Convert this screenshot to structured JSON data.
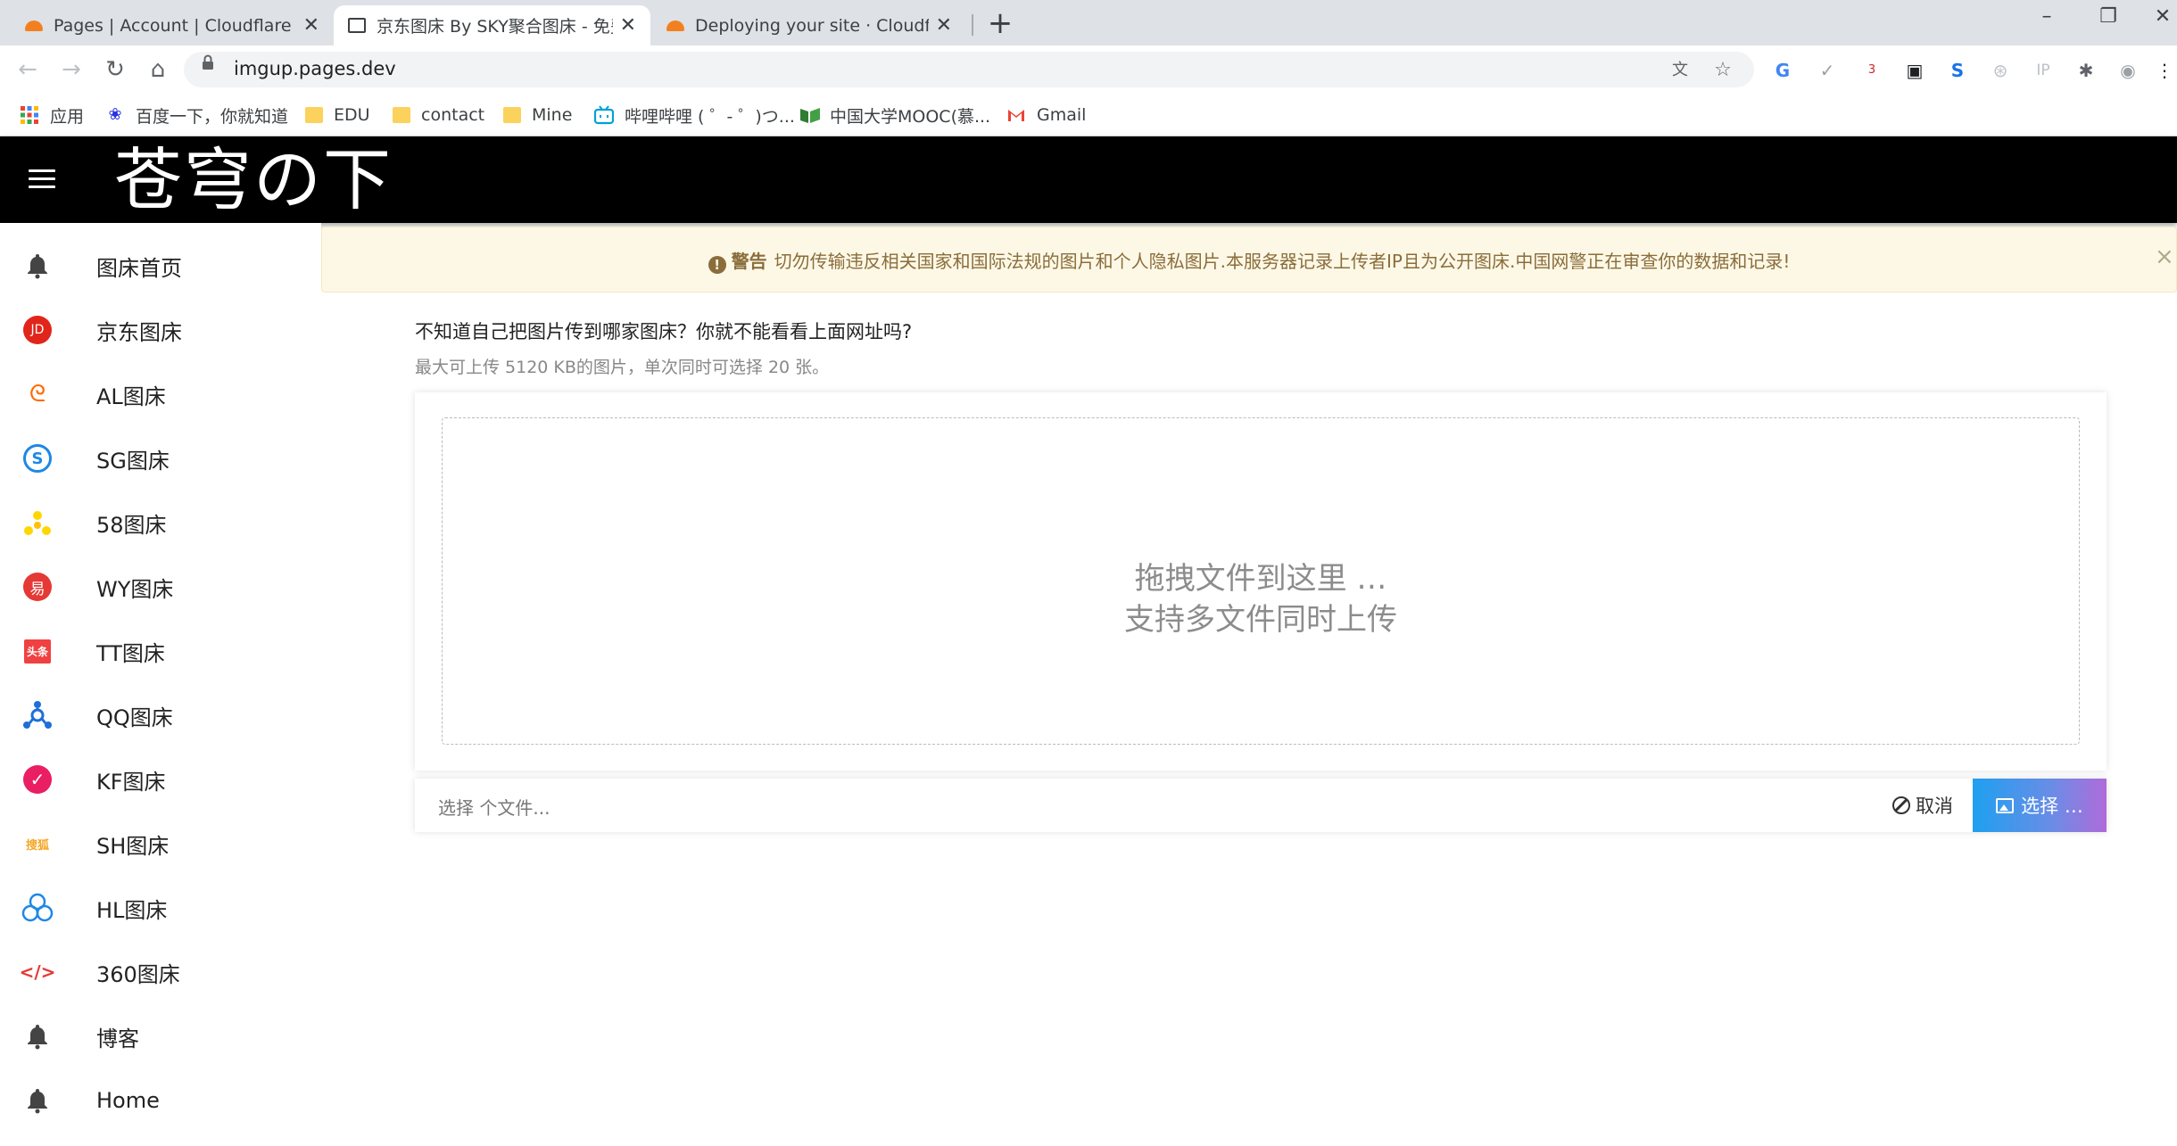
{
  "browser": {
    "tabs": [
      {
        "title": "Pages | Account | Cloudflare -",
        "close": "✕",
        "icon_color": "#f38020"
      },
      {
        "title": "京东图床 By SKY聚合图床 - 免费",
        "close": "✕",
        "icon_color": "#3c4043"
      },
      {
        "title": "Deploying your site · Cloudflar",
        "close": "✕",
        "icon_color": "#f38020"
      }
    ],
    "new_tab": "+",
    "window": {
      "minimize": "–",
      "restore": "❐",
      "close": "✕"
    },
    "nav": {
      "back": "←",
      "forward": "→",
      "reload": "↻",
      "home": "⌂"
    },
    "url": "imgup.pages.dev",
    "omnibox_icons": {
      "translate": "文",
      "star": "☆"
    },
    "extensions": [
      "G",
      "✓",
      "3",
      "▣",
      "S",
      "⊛",
      "IP",
      "✱",
      "◉",
      "⋮"
    ],
    "bookmarks": [
      {
        "label": "应用",
        "icon": "apps-icon"
      },
      {
        "label": "百度一下，你就知道",
        "icon": "baidu-icon"
      },
      {
        "label": "EDU",
        "icon": "folder-icon"
      },
      {
        "label": "contact",
        "icon": "folder-icon"
      },
      {
        "label": "Mine",
        "icon": "folder-icon"
      },
      {
        "label": "哔哩哔哩 ( ゜- ゜)つ...",
        "icon": "bilibili-icon"
      },
      {
        "label": "中国大学MOOC(慕...",
        "icon": "mooc-icon"
      },
      {
        "label": "Gmail",
        "icon": "gmail-icon"
      }
    ]
  },
  "site": {
    "title": "苍穹の下",
    "header_bg": "#000000"
  },
  "sidebar": {
    "items": [
      {
        "label": "图床首页",
        "icon": "bell-icon"
      },
      {
        "label": "京东图床",
        "icon": "jd-icon",
        "icon_text": "JD"
      },
      {
        "label": "AL图床",
        "icon": "alibaba-icon",
        "icon_text": "ᘓ"
      },
      {
        "label": "SG图床",
        "icon": "sogou-icon",
        "icon_text": "S"
      },
      {
        "label": "58图床",
        "icon": "58-icon"
      },
      {
        "label": "WY图床",
        "icon": "netease-icon",
        "icon_text": "易"
      },
      {
        "label": "TT图床",
        "icon": "toutiao-icon",
        "icon_text": "头条"
      },
      {
        "label": "QQ图床",
        "icon": "qq-icon"
      },
      {
        "label": "KF图床",
        "icon": "check-circle-icon",
        "icon_text": "✓"
      },
      {
        "label": "SH图床",
        "icon": "sohu-icon",
        "icon_text": "搜狐"
      },
      {
        "label": "HL图床",
        "icon": "hl-icon"
      },
      {
        "label": "360图床",
        "icon": "code-icon",
        "icon_text": "</>"
      },
      {
        "label": "博客",
        "icon": "bell-icon"
      },
      {
        "label": "Home",
        "icon": "bell-icon"
      }
    ]
  },
  "warning": {
    "icon": "!",
    "label": "警告",
    "text": "切勿传输违反相关国家和国际法规的图片和个人隐私图片.本服务器记录上传者IP且为公开图床.中国网警正在审查你的数据和记录!",
    "close": "×"
  },
  "main": {
    "hint_title": "不知道自己把图片传到哪家图床？你就不能看看上面网址吗?",
    "hint_sub": "最大可上传 5120 KB的图片，单次同时可选择 20 张。",
    "drop_line1": "拖拽文件到这里 …",
    "drop_line2": "支持多文件同时上传",
    "file_caption": "选择 个文件...",
    "cancel_label": "取消",
    "browse_label": "选择 …"
  }
}
